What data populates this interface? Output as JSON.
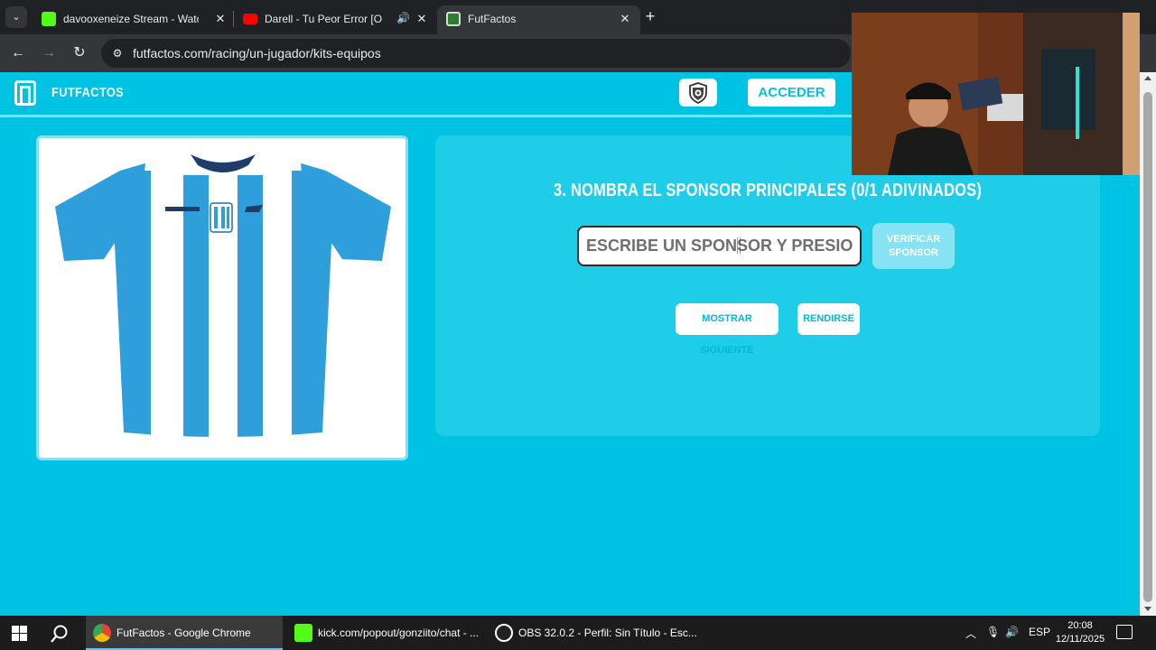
{
  "browser": {
    "tabs": [
      {
        "title": "davooxeneize Stream - Watch L",
        "active": false,
        "favicon_color": "#53fc18"
      },
      {
        "title": "Darell - Tu Peor Error [Offici",
        "active": false,
        "favicon_color": "#ff0000",
        "audio_icon": "🔊"
      },
      {
        "title": "FutFactos",
        "active": true,
        "favicon_color": "#c8e6c9"
      }
    ],
    "new_tab_label": "+",
    "url": "futfactos.com/racing/un-jugador/kits-equipos"
  },
  "site": {
    "brand": "FUTFACTOS",
    "login_label": "ACCEDER",
    "accent_color": "#00c3e3"
  },
  "quiz": {
    "question": "3. NOMBRA EL SPONSOR PRINCIPALES (0/1 ADIVINADOS)",
    "input_placeholder": "ESCRIBE UN SPONSOR Y PRESIONA ENTER",
    "input_value": "",
    "verify_label": "VERIFICAR SPONSOR",
    "next_label": "MOSTRAR SIGUIENTE",
    "give_up_label": "RENDIRSE"
  },
  "taskbar": {
    "items": [
      {
        "label": "FutFactos - Google Chrome",
        "active": true
      },
      {
        "label": "kick.com/popout/gonziito/chat - ...",
        "active": false
      },
      {
        "label": "OBS 32.0.2 - Perfil: Sin Título - Esc...",
        "active": false
      }
    ],
    "language": "ESP",
    "time": "20:08",
    "date": "12/11/2025"
  }
}
